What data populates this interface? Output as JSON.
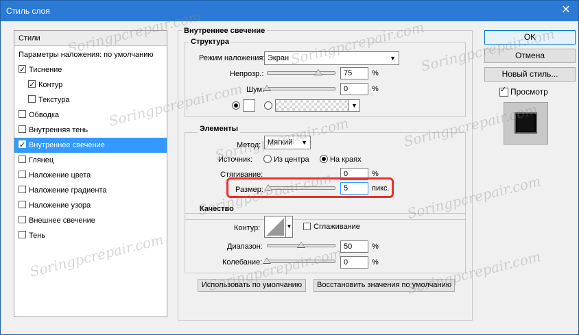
{
  "window": {
    "title": "Стиль слоя",
    "close_glyph": "✕"
  },
  "styles_list": {
    "header": "Стили",
    "defaults": "Параметры наложения: по умолчанию",
    "items": [
      {
        "label": "Тиснение",
        "checked": true
      },
      {
        "label": "Контур",
        "checked": true
      },
      {
        "label": "Текстура",
        "checked": false
      },
      {
        "label": "Обводка",
        "checked": false
      },
      {
        "label": "Внутренняя тень",
        "checked": false
      },
      {
        "label": "Внутреннее свечение",
        "checked": true
      },
      {
        "label": "Глянец",
        "checked": false
      },
      {
        "label": "Наложение цвета",
        "checked": false
      },
      {
        "label": "Наложение градиента",
        "checked": false
      },
      {
        "label": "Наложение узора",
        "checked": false
      },
      {
        "label": "Внешнее свечение",
        "checked": false
      },
      {
        "label": "Тень",
        "checked": false
      }
    ]
  },
  "panel": {
    "title": "Внутреннее свечение",
    "structure": {
      "title": "Структура",
      "blend_label": "Режим наложения:",
      "blend_value": "Экран",
      "opacity_label": "Непрозр.:",
      "opacity_value": "75",
      "opacity_unit": "%",
      "opacity_level": 0.75,
      "noise_label": "Шум:",
      "noise_value": "0",
      "noise_unit": "%",
      "noise_level": 0
    },
    "elements": {
      "title": "Элементы",
      "method_label": "Метод:",
      "method_value": "Мягкий",
      "source_label": "Источник:",
      "source_center": "Из центра",
      "source_edge": "На краях",
      "choke_label": "Стягивание:",
      "choke_value": "0",
      "choke_unit": "%",
      "choke_level": 0,
      "size_label": "Размер:",
      "size_value": "5",
      "size_unit": "пикс.",
      "size_level": 0.02
    },
    "quality": {
      "title": "Качество",
      "contour_label": "Контур:",
      "antialias_label": "Сглаживание",
      "range_label": "Диапазон:",
      "range_value": "50",
      "range_unit": "%",
      "range_level": 0.5,
      "jitter_label": "Колебание:",
      "jitter_value": "0",
      "jitter_unit": "%",
      "jitter_level": 0
    },
    "default_button": "Использовать по умолчанию",
    "reset_button": "Восстановить значения по умолчанию"
  },
  "buttons": {
    "ok": "OK",
    "cancel": "Отмена",
    "new_style": "Новый стиль...",
    "preview_label": "Просмотр"
  },
  "highlight_color": "#e8302a",
  "watermark": "Soringpcrepair.com"
}
